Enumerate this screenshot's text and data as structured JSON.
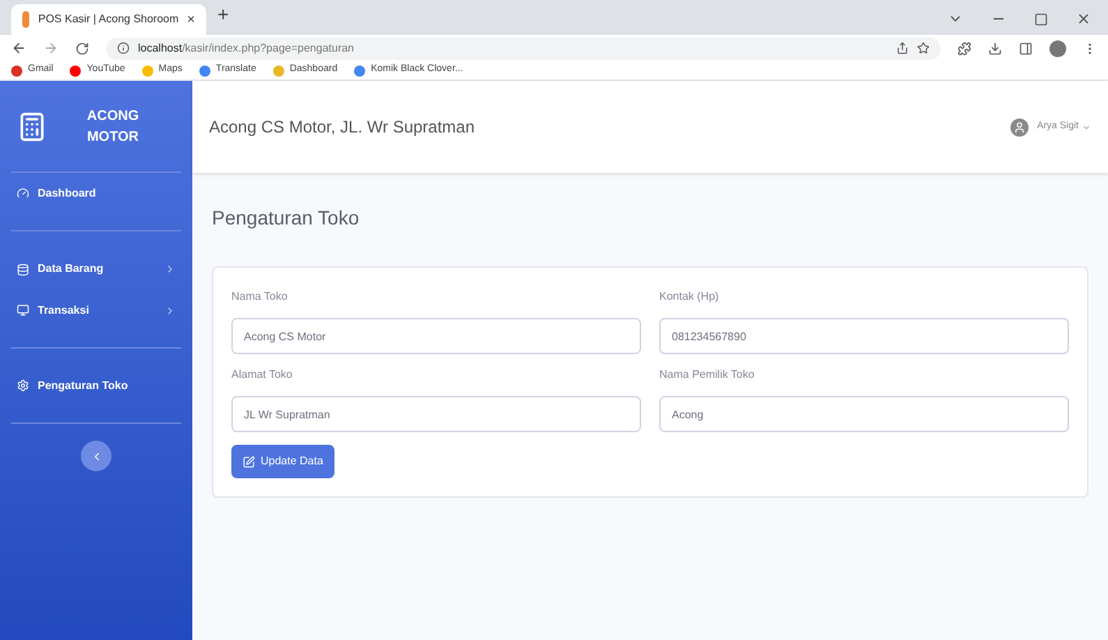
{
  "browser": {
    "tab_title": "POS Kasir | Acong Shoroom",
    "tab_close": "×",
    "new_tab": "+",
    "url_host": "localhost",
    "url_path": "/kasir/index.php?page=pengaturan",
    "bookmarks": [
      {
        "label": "Gmail",
        "color": "#d93025"
      },
      {
        "label": "YouTube",
        "color": "#ff0000"
      },
      {
        "label": "Maps",
        "color": "#fbbc04"
      },
      {
        "label": "Translate",
        "color": "#4285f4"
      },
      {
        "label": "Dashboard",
        "color": "#e8b923"
      },
      {
        "label": "Komik Black Clover...",
        "color": "#4285f4"
      }
    ]
  },
  "sidebar": {
    "brand": "ACONG MOTOR",
    "items": [
      {
        "label": "Dashboard",
        "has_submenu": false,
        "divider_after": true
      },
      {
        "label": "Data Barang",
        "has_submenu": true,
        "divider_after": false
      },
      {
        "label": "Transaksi",
        "has_submenu": true,
        "divider_after": true
      },
      {
        "label": "Pengaturan Toko",
        "has_submenu": false,
        "divider_after": true
      }
    ]
  },
  "topbar": {
    "store": "Acong CS Motor, JL. Wr Supratman",
    "user": "Arya Sigit"
  },
  "page_title": "Pengaturan Toko",
  "form": {
    "fields": [
      {
        "label": "Nama Toko",
        "value": "Acong CS Motor"
      },
      {
        "label": "Kontak (Hp)",
        "value": "081234567890"
      },
      {
        "label": "Alamat Toko",
        "value": "JL Wr Supratman"
      },
      {
        "label": "Nama Pemilik Toko",
        "value": "Acong"
      }
    ],
    "button": "Update Data"
  }
}
